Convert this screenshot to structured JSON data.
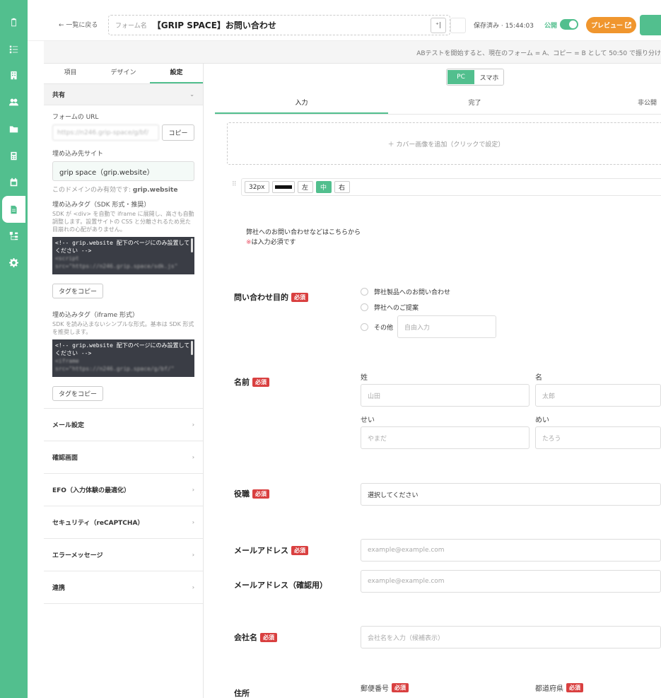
{
  "header": {
    "back": "← 一覧に戻る",
    "title_label": "フォーム名",
    "title": "【GRIP SPACE】お問い合わせ",
    "undo": "⁺|",
    "save_status": "保存済み · 15:44:03",
    "publish_label": "公開",
    "preview": "プレビュー"
  },
  "ab_banner": "ABテストを開始すると、現在のフォーム = A、コピー = B として 50:50 で振り分け",
  "left_panel": {
    "tabs": [
      "項目",
      "デザイン",
      "設定"
    ],
    "section": "共有",
    "form_url_label": "フォームの URL",
    "form_url": "https://n246.grip-space/g/bf/",
    "copy": "コピー",
    "embed_site_label": "埋め込み先サイト",
    "embed_site": "grip space（grip.website）",
    "domain_note": "このドメインのみ有効です:",
    "domain": "grip.website",
    "sdk_label": "埋め込みタグ（SDK 形式・推奨）",
    "sdk_desc": "SDK が <div> を自動で iframe に展開し、高さも自動調整します。設置サイトの CSS と分離されるため見た目崩れの心配がありません。",
    "sdk_code_1": "<!-- grip.website 配下のページにのみ設置してください -->",
    "sdk_code_2": "<script",
    "sdk_code_3": "src=\"https://n246.grip.space/sdk.js\"",
    "tag_copy": "タグをコピー",
    "iframe_label": "埋め込みタグ（iframe 形式）",
    "iframe_desc": "SDK を読み込まないシンプルな形式。基本は SDK 形式を推奨します。",
    "iframe_code_1": "<!-- grip.website 配下のページにのみ設置してください -->",
    "iframe_code_2": "<iframe",
    "iframe_code_3": "src=\"https://n246.grip.space/g/bf/\"",
    "accordion": [
      "メール設定",
      "確認画面",
      "EFO（入力体験の最適化）",
      "セキュリティ（reCAPTCHA）",
      "エラーメッセージ",
      "連携"
    ]
  },
  "main": {
    "device": [
      "PC",
      "スマホ"
    ],
    "tabs": [
      "入力",
      "完了",
      "非公開"
    ],
    "cover": "＋ カバー画像を追加（クリックで設定）",
    "format": {
      "size": "32px",
      "left": "左",
      "center": "中",
      "right": "右"
    },
    "intro_1": "弊社へのお問い合わせなどはこちらから",
    "intro_2_mark": "※",
    "intro_2": "は入力必須です",
    "required": "必須",
    "q_purpose": "問い合わせ目的",
    "opt_1": "弊社製品へのお問い合わせ",
    "opt_2": "弊社へのご提案",
    "opt_3": "その他",
    "free_input": "自由入力",
    "q_name": "名前",
    "last_name": "姓",
    "first_name": "名",
    "last_name_ph": "山田",
    "first_name_ph": "太郎",
    "last_kana": "せい",
    "first_kana": "めい",
    "last_kana_ph": "やまだ",
    "first_kana_ph": "たろう",
    "q_role": "役職",
    "role_select": "選択してください",
    "q_email": "メールアドレス",
    "email_ph": "example@example.com",
    "q_email_confirm": "メールアドレス（確認用）",
    "q_company": "会社名",
    "company_ph": "会社名を入力（候補表示）",
    "q_address": "住所",
    "postal": "郵便番号",
    "prefecture": "都道府県"
  }
}
